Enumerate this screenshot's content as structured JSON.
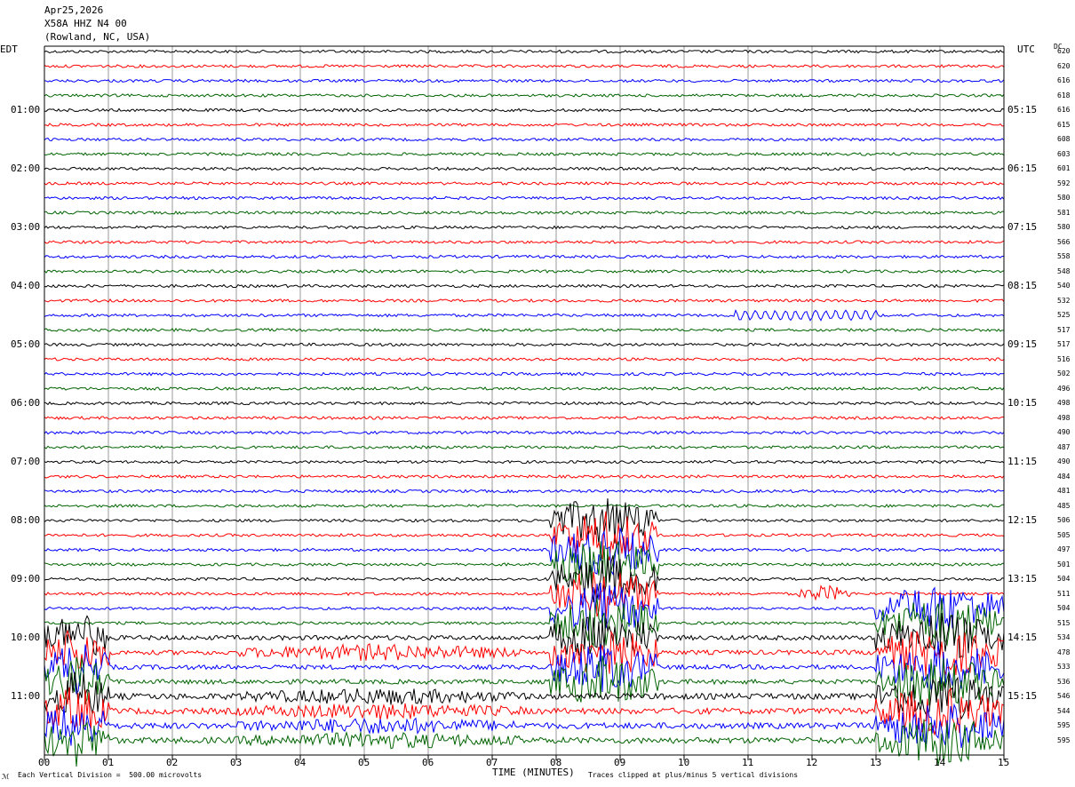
{
  "header": {
    "date": "Apr25,2026",
    "station": "X58A HHZ N4 00",
    "location": "(Rowland, NC, USA)"
  },
  "labels": {
    "left_tz": "EDT",
    "right_tz": "UTC",
    "dc": "DC",
    "xlabel": "TIME (MINUTES)",
    "footer_left": "Each Vertical Division =  500.00 microvolts",
    "footer_right": "Traces clipped at plus/minus 5 vertical divisions",
    "corner_mark": "ℳ"
  },
  "chart_data": {
    "type": "line",
    "title": "X58A HHZ N4 00 (Rowland, NC, USA)",
    "xlabel": "TIME (MINUTES)",
    "xlim": [
      0,
      15
    ],
    "x_ticks": [
      "00",
      "01",
      "02",
      "03",
      "04",
      "05",
      "06",
      "07",
      "08",
      "09",
      "10",
      "11",
      "12",
      "13",
      "14",
      "15"
    ],
    "row_duration_minutes": 15,
    "rows": 48,
    "trace_colors": [
      "#000000",
      "#ff0000",
      "#0000ff",
      "#006400"
    ],
    "grid": true,
    "left_hour_labels": [
      "01:00",
      "02:00",
      "03:00",
      "04:00",
      "05:00",
      "06:00",
      "07:00",
      "08:00",
      "09:00",
      "10:00",
      "11:00"
    ],
    "right_hour_labels": [
      "05:15",
      "06:15",
      "07:15",
      "08:15",
      "09:15",
      "10:15",
      "11:15",
      "12:15",
      "13:15",
      "14:15",
      "15:15"
    ],
    "dc_offsets": [
      620,
      620,
      616,
      618,
      616,
      615,
      608,
      603,
      601,
      592,
      580,
      581,
      580,
      566,
      558,
      548,
      540,
      532,
      525,
      517,
      517,
      516,
      502,
      496,
      498,
      498,
      490,
      487,
      490,
      484,
      481,
      485,
      506,
      505,
      497,
      501,
      504,
      511,
      504,
      515,
      534,
      478,
      533,
      536,
      546,
      544,
      595,
      595
    ],
    "vertical_division_microvolts": 500.0,
    "clip_divisions": 5,
    "events": [
      {
        "rows": [
          18
        ],
        "x_start": 10.8,
        "x_end": 13.0,
        "amplitude": "moderate long-period"
      },
      {
        "rows": [
          32,
          33,
          34,
          35,
          36,
          37,
          38,
          39,
          40,
          41,
          42,
          43
        ],
        "x_start": 7.9,
        "x_end": 9.6,
        "amplitude": "large"
      },
      {
        "rows": [
          37
        ],
        "x_start": 11.8,
        "x_end": 12.6,
        "amplitude": "moderate"
      },
      {
        "rows": [
          38,
          39,
          40,
          41,
          42,
          43,
          44,
          45,
          46,
          47
        ],
        "x_start": 13.0,
        "x_end": 15.0,
        "amplitude": "large"
      },
      {
        "rows": [
          40,
          41,
          42,
          43,
          44,
          45,
          46,
          47
        ],
        "x_start": 0.0,
        "x_end": 1.0,
        "amplitude": "large"
      },
      {
        "rows": [
          41,
          44,
          45,
          46,
          47
        ],
        "x_start": 3.0,
        "x_end": 7.5,
        "amplitude": "moderate"
      }
    ]
  }
}
